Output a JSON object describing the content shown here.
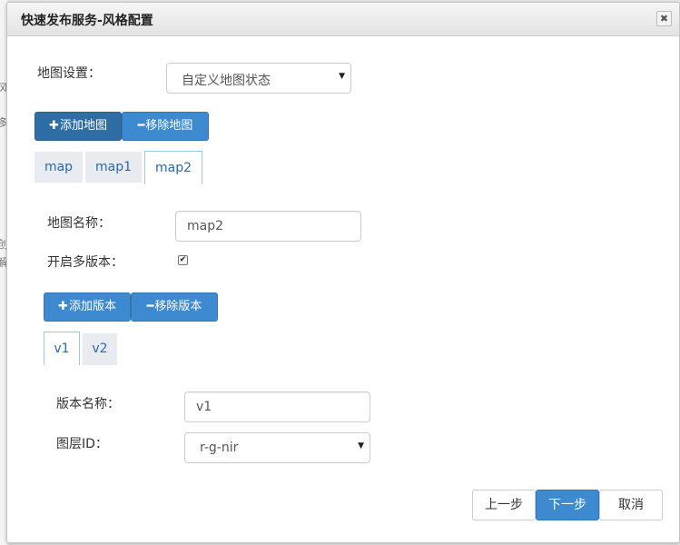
{
  "background": {
    "left_edge_text": [
      "风",
      "多",
      "创",
      "解"
    ]
  },
  "dialog": {
    "title": "快速发布服务-风格配置",
    "close_glyph": "✖"
  },
  "map_settings": {
    "label": "地图设置：",
    "selected": "自定义地图状态",
    "arrow": "▼"
  },
  "map_buttons": {
    "add_icon": "✚",
    "add_label": "添加地图",
    "remove_icon": "━",
    "remove_label": "移除地图"
  },
  "map_tabs": [
    {
      "label": "map",
      "active": false
    },
    {
      "label": "map1",
      "active": false
    },
    {
      "label": "map2",
      "active": true
    }
  ],
  "map_form": {
    "name_label": "地图名称：",
    "name_value": "map2",
    "multi_version_label": "开启多版本：",
    "multi_version_checked": true,
    "check_glyph": "✔"
  },
  "version_buttons": {
    "add_icon": "✚",
    "add_label": "添加版本",
    "remove_icon": "━",
    "remove_label": "移除版本"
  },
  "version_tabs": [
    {
      "label": "v1",
      "active": true
    },
    {
      "label": "v2",
      "active": false
    }
  ],
  "version_form": {
    "name_label": "版本名称：",
    "name_value": "v1",
    "layer_label": "图层ID：",
    "layer_selected": "r-g-nir",
    "arrow": "▼"
  },
  "footer": {
    "prev_label": "上一步",
    "next_label": "下一步",
    "cancel_label": "取消"
  },
  "colors": {
    "primary": "#3d8ad0",
    "primary_dark": "#2f6ea5",
    "tab_text": "#2a6aa8"
  }
}
